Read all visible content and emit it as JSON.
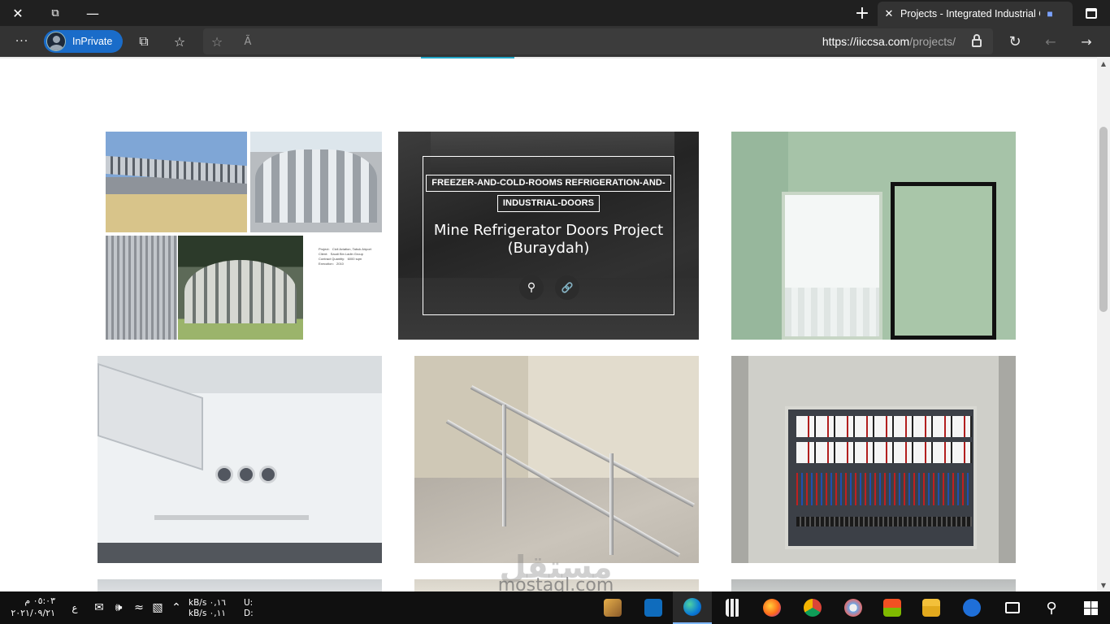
{
  "window": {
    "close_label": "✕",
    "restore_label": "⧉",
    "minimize_label": "—"
  },
  "tab": {
    "title": "Projects - Integrated Industrial C",
    "close_label": "✕",
    "new_tab_label": "+"
  },
  "toolbar": {
    "more_label": "···",
    "profile_label": "InPrivate",
    "read_aloud_label": "Ã",
    "url_main": "https://iiccsa.com",
    "url_path": "/projects/"
  },
  "projects": {
    "featured": {
      "category_line1": "FREEZER-AND-COLD-ROOMS REFRIGERATION-AND-",
      "category_line2": "INDUSTRIAL-DOORS",
      "title": "Mine Refrigerator Doors Project (Buraydah)"
    },
    "collage_caption": "Project:   Civil Aviation, Tabuk Airport\nClient:   Saudi Bin Ladin Group\nContract Quantity:   6000 sqm\nExecution:   2010"
  },
  "watermark": {
    "arabic": "مستقل",
    "latin": "mostaql.com"
  },
  "taskbar": {
    "time": "٠٥:٠٣ م",
    "date": "٢٠٢١/٠٩/٢١",
    "lang": "ع",
    "net_up": "kB/s ٠,١٦",
    "net_down": "kB/s ٠,١١",
    "drive_u": "U:",
    "drive_d": "D:"
  },
  "colors": {
    "accent": "#1a6cc9",
    "menu_active": "#23a6c6",
    "chrome_dark": "#202020",
    "toolbar": "#333333"
  }
}
